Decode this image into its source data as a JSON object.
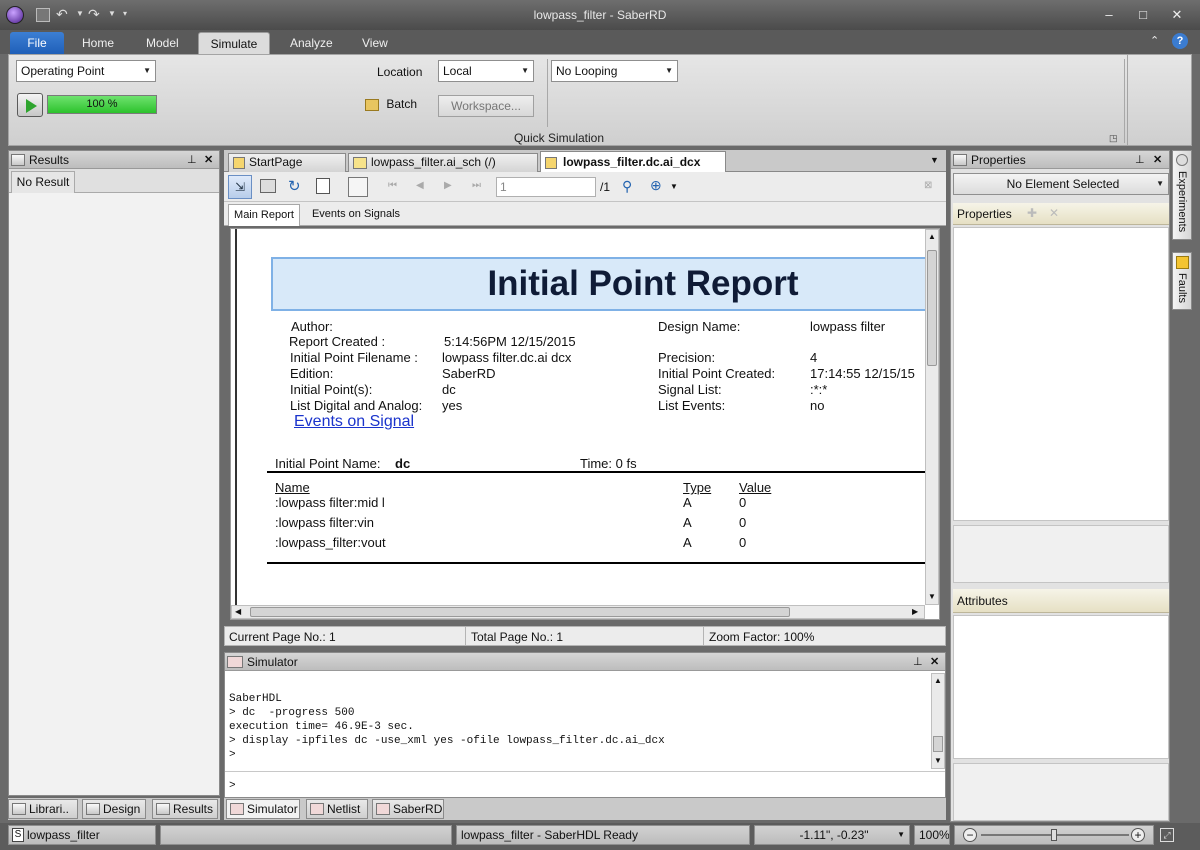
{
  "window": {
    "title": "lowpass_filter - SaberRD"
  },
  "ribbon": {
    "tabs": [
      "File",
      "Home",
      "Model",
      "Simulate",
      "Analyze",
      "View"
    ],
    "active_tab": "Simulate",
    "analysis_select": "Operating Point",
    "progress_text": "100 %",
    "progress": 1.0,
    "location_label": "Location",
    "location_value": "Local",
    "looping_value": "No Looping",
    "batch_label": "Batch",
    "workspace_label": "Workspace...",
    "group_label": "Quick Simulation"
  },
  "results_panel": {
    "title": "Results",
    "tab": "No Result"
  },
  "doc_tabs": [
    "StartPage",
    "lowpass_filter.ai_sch (/)",
    "lowpass_filter.dc.ai_dcx"
  ],
  "doc_toolbar": {
    "page_input": "1",
    "page_total": "/1"
  },
  "report_tabs": [
    "Main Report",
    "Events on Signals"
  ],
  "report": {
    "title": "Initial Point Report",
    "left_labels": [
      "Author:",
      "Report Created :",
      "Initial Point Filename :",
      "Edition:",
      "Initial Point(s):",
      "List Digital and Analog:"
    ],
    "left_values": [
      "",
      "5:14:56PM   12/15/2015",
      "lowpass  filter.dc.ai  dcx",
      "SaberRD",
      "dc",
      "yes"
    ],
    "right_labels": [
      "Design Name:",
      "",
      "Precision:",
      "Initial Point Created:",
      "Signal List:",
      "List Events:"
    ],
    "right_values": [
      "lowpass  filter",
      "",
      "4",
      "17:14:55    12/15/15",
      ":*:*",
      "no"
    ],
    "events_link": "Events on Signal",
    "ip_name_label": "Initial Point Name:",
    "ip_name_value": "dc",
    "time_label": "Time:  0 fs",
    "col_name": "Name",
    "col_type": "Type",
    "col_value": "Value",
    "rows": [
      {
        "name": ":lowpass  filter:mid  l",
        "type": "A",
        "value": "0"
      },
      {
        "name": ":lowpass  filter:vin",
        "type": "A",
        "value": "0"
      },
      {
        "name": ":lowpass_filter:vout",
        "type": "A",
        "value": "0"
      }
    ]
  },
  "page_status": {
    "current": "Current Page No.: 1",
    "total": "Total Page No.: 1",
    "zoom": "Zoom Factor: 100%"
  },
  "simulator": {
    "title": "Simulator",
    "lines": [
      "SaberHDL",
      "> dc  -progress 500",
      "execution time= 46.9E-3 sec.",
      "> display -ipfiles dc -use_xml yes -ofile lowpass_filter.dc.ai_dcx",
      ">"
    ],
    "prompt": ">"
  },
  "bottom_tabs_left": [
    "Librari..",
    "Design",
    "Results"
  ],
  "bottom_tabs_center": [
    "Simulator",
    "Netlist",
    "SaberRD"
  ],
  "properties_panel": {
    "title": "Properties",
    "selection": "No Element Selected",
    "tab": "Properties",
    "attributes_label": "Attributes"
  },
  "side_tabs": [
    "Experiments",
    "Faults"
  ],
  "statusbar": {
    "project": "lowpass_filter",
    "message": "lowpass_filter - SaberHDL Ready",
    "coords": "-1.11\", -0.23\"",
    "zoom": "100%"
  }
}
